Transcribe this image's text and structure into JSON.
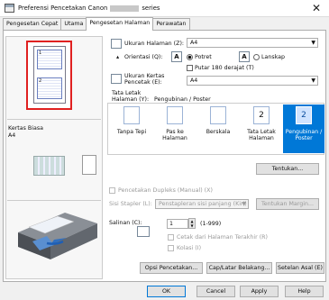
{
  "window": {
    "title_prefix": "Preferensi Pencetakan Canon",
    "title_suffix": "series",
    "close": "✕"
  },
  "tabs": [
    "Pengesetan Cepat",
    "Utama",
    "Pengesetan Halaman",
    "Perawatan"
  ],
  "left": {
    "media_label": "Kertas Biasa",
    "media_size": "A4",
    "preview_page_a": "1",
    "preview_page_b": "2"
  },
  "page_size": {
    "label": "Ukuran Halaman (Z):",
    "value": "A4"
  },
  "orientation": {
    "label": "Orientasi (Q):",
    "portrait": "Potret",
    "landscape": "Lanskap",
    "rotate_label": "Putar 180 derajat (T)",
    "icon_portrait": "A",
    "icon_landscape": "A"
  },
  "printer_paper": {
    "label_line1": "Ukuran Kertas",
    "label_line2": "Pencetak (E):",
    "value": "A4"
  },
  "page_layout": {
    "label_line1": "Tata Letak",
    "label_line2": "Halaman (Y):",
    "current": "Pengubinan / Poster",
    "items": [
      {
        "label": "Tanpa Tepi",
        "glyph": ""
      },
      {
        "label": "Pas ke Halaman",
        "glyph": ""
      },
      {
        "label": "Berskala",
        "glyph": ""
      },
      {
        "label": "Tata Letak Halaman",
        "glyph": "2"
      },
      {
        "label": "Pengubinan / Poster",
        "glyph": "2"
      }
    ]
  },
  "specify_button": "Tentukan...",
  "duplex": {
    "label": "Pencetakan Dupleks (Manual) (X)",
    "staple_label": "Sisi Stapler (L):",
    "staple_value": "Penstapleran sisi panjang (Kiri)",
    "margin_button": "Tentukan Margin..."
  },
  "copies": {
    "label": "Salinan (C):",
    "value": "1",
    "range": "(1-999)",
    "last_page": "Cetak dari Halaman Terakhir (R)",
    "collate": "Kolasi (I)"
  },
  "bottom_buttons": [
    "Opsi Pencetakan...",
    "Cap/Latar Belakang...",
    "Setelan Asal (E)"
  ],
  "dialog_buttons": [
    "OK",
    "Cancel",
    "Apply",
    "Help"
  ]
}
